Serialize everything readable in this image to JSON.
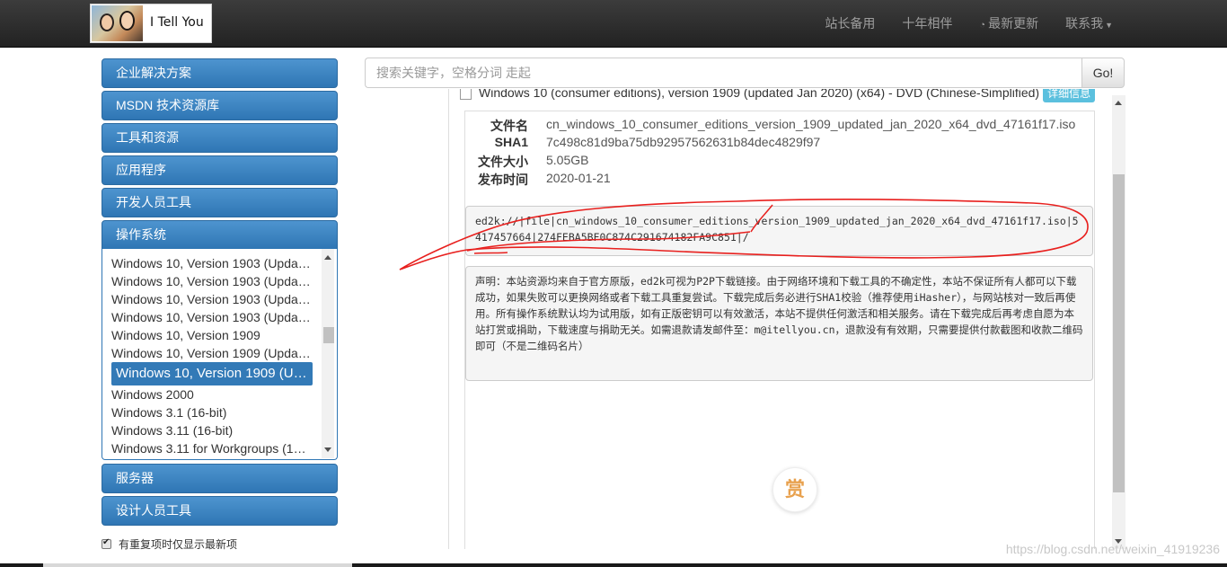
{
  "header": {
    "logo_text": "I Tell You",
    "nav": [
      {
        "label": "站长备用",
        "icon": ""
      },
      {
        "label": "十年相伴",
        "icon": ""
      },
      {
        "label": "最新更新",
        "icon": "rss-icon"
      },
      {
        "label": "联系我",
        "icon": "caret-down-icon"
      }
    ]
  },
  "sidebar": {
    "categories_top": [
      "企业解决方案",
      "MSDN 技术资源库",
      "工具和资源",
      "应用程序",
      "开发人员工具",
      "操作系统"
    ],
    "os_items": [
      "Windows 10, Version 1903 (Upda…",
      "Windows 10, Version 1903 (Upda…",
      "Windows 10, Version 1903 (Upda…",
      "Windows 10, Version 1903 (Upda…",
      "Windows 10, Version 1909",
      "Windows 10, Version 1909 (Upda…",
      "Windows 10, Version 1909 (Upd…",
      "Windows 2000",
      "Windows 3.1 (16-bit)",
      "Windows 3.11 (16-bit)",
      "Windows 3.11 for Workgroups (1…"
    ],
    "active_index": 6,
    "categories_bottom": [
      "服务器",
      "设计人员工具"
    ],
    "dedupe_label": "有重复项时仅显示最新项"
  },
  "search": {
    "placeholder": "搜索关键字，空格分词 走起",
    "button": "Go!"
  },
  "content": {
    "cut_row_text": "Windows 10 (consumer editions), version 1909 (updated Jan 2020) (x64) - DVD (Chinese-Simplified)",
    "cut_row_badge": "详细信息",
    "meta": [
      {
        "key": "文件名",
        "value": "cn_windows_10_consumer_editions_version_1909_updated_jan_2020_x64_dvd_47161f17.iso"
      },
      {
        "key": "SHA1",
        "value": "7c498c81d9ba75db92957562631b84dec4829f97"
      },
      {
        "key": "文件大小",
        "value": "5.05GB"
      },
      {
        "key": "发布时间",
        "value": "2020-01-21"
      }
    ],
    "ed2k": "ed2k://|file|cn_windows_10_consumer_editions_version_1909_updated_jan_2020_x64_dvd_47161f17.iso|5417457664|274FEBA5BF0C874C291674182FA9C851|/",
    "notice": "声明：本站资源均来自于官方原版，ed2k可视为P2P下载链接。由于网络环境和下载工具的不确定性，本站不保证所有人都可以下载成功，如果失败可以更换网络或者下载工具重复尝试。下载完成后务必进行SHA1校验（推荐使用iHasher），与网站核对一致后再使用。所有操作系统默认均为试用版，如有正版密钥可以有效激活，本站不提供任何激活和相关服务。请在下载完成后再考虑自愿为本站打赏或捐助，下载速度与捐助无关。如需退款请发邮件至：m@itellyou.cn，退款没有有效期，只需要提供付款截图和收款二维码即可（不是二维码名片）",
    "reward_label": "赏"
  },
  "watermark": "https://blog.csdn.net/weixin_41919236",
  "colors": {
    "accent": "#337ab7",
    "annotation": "#e8201e",
    "reward": "#e8a14e"
  }
}
